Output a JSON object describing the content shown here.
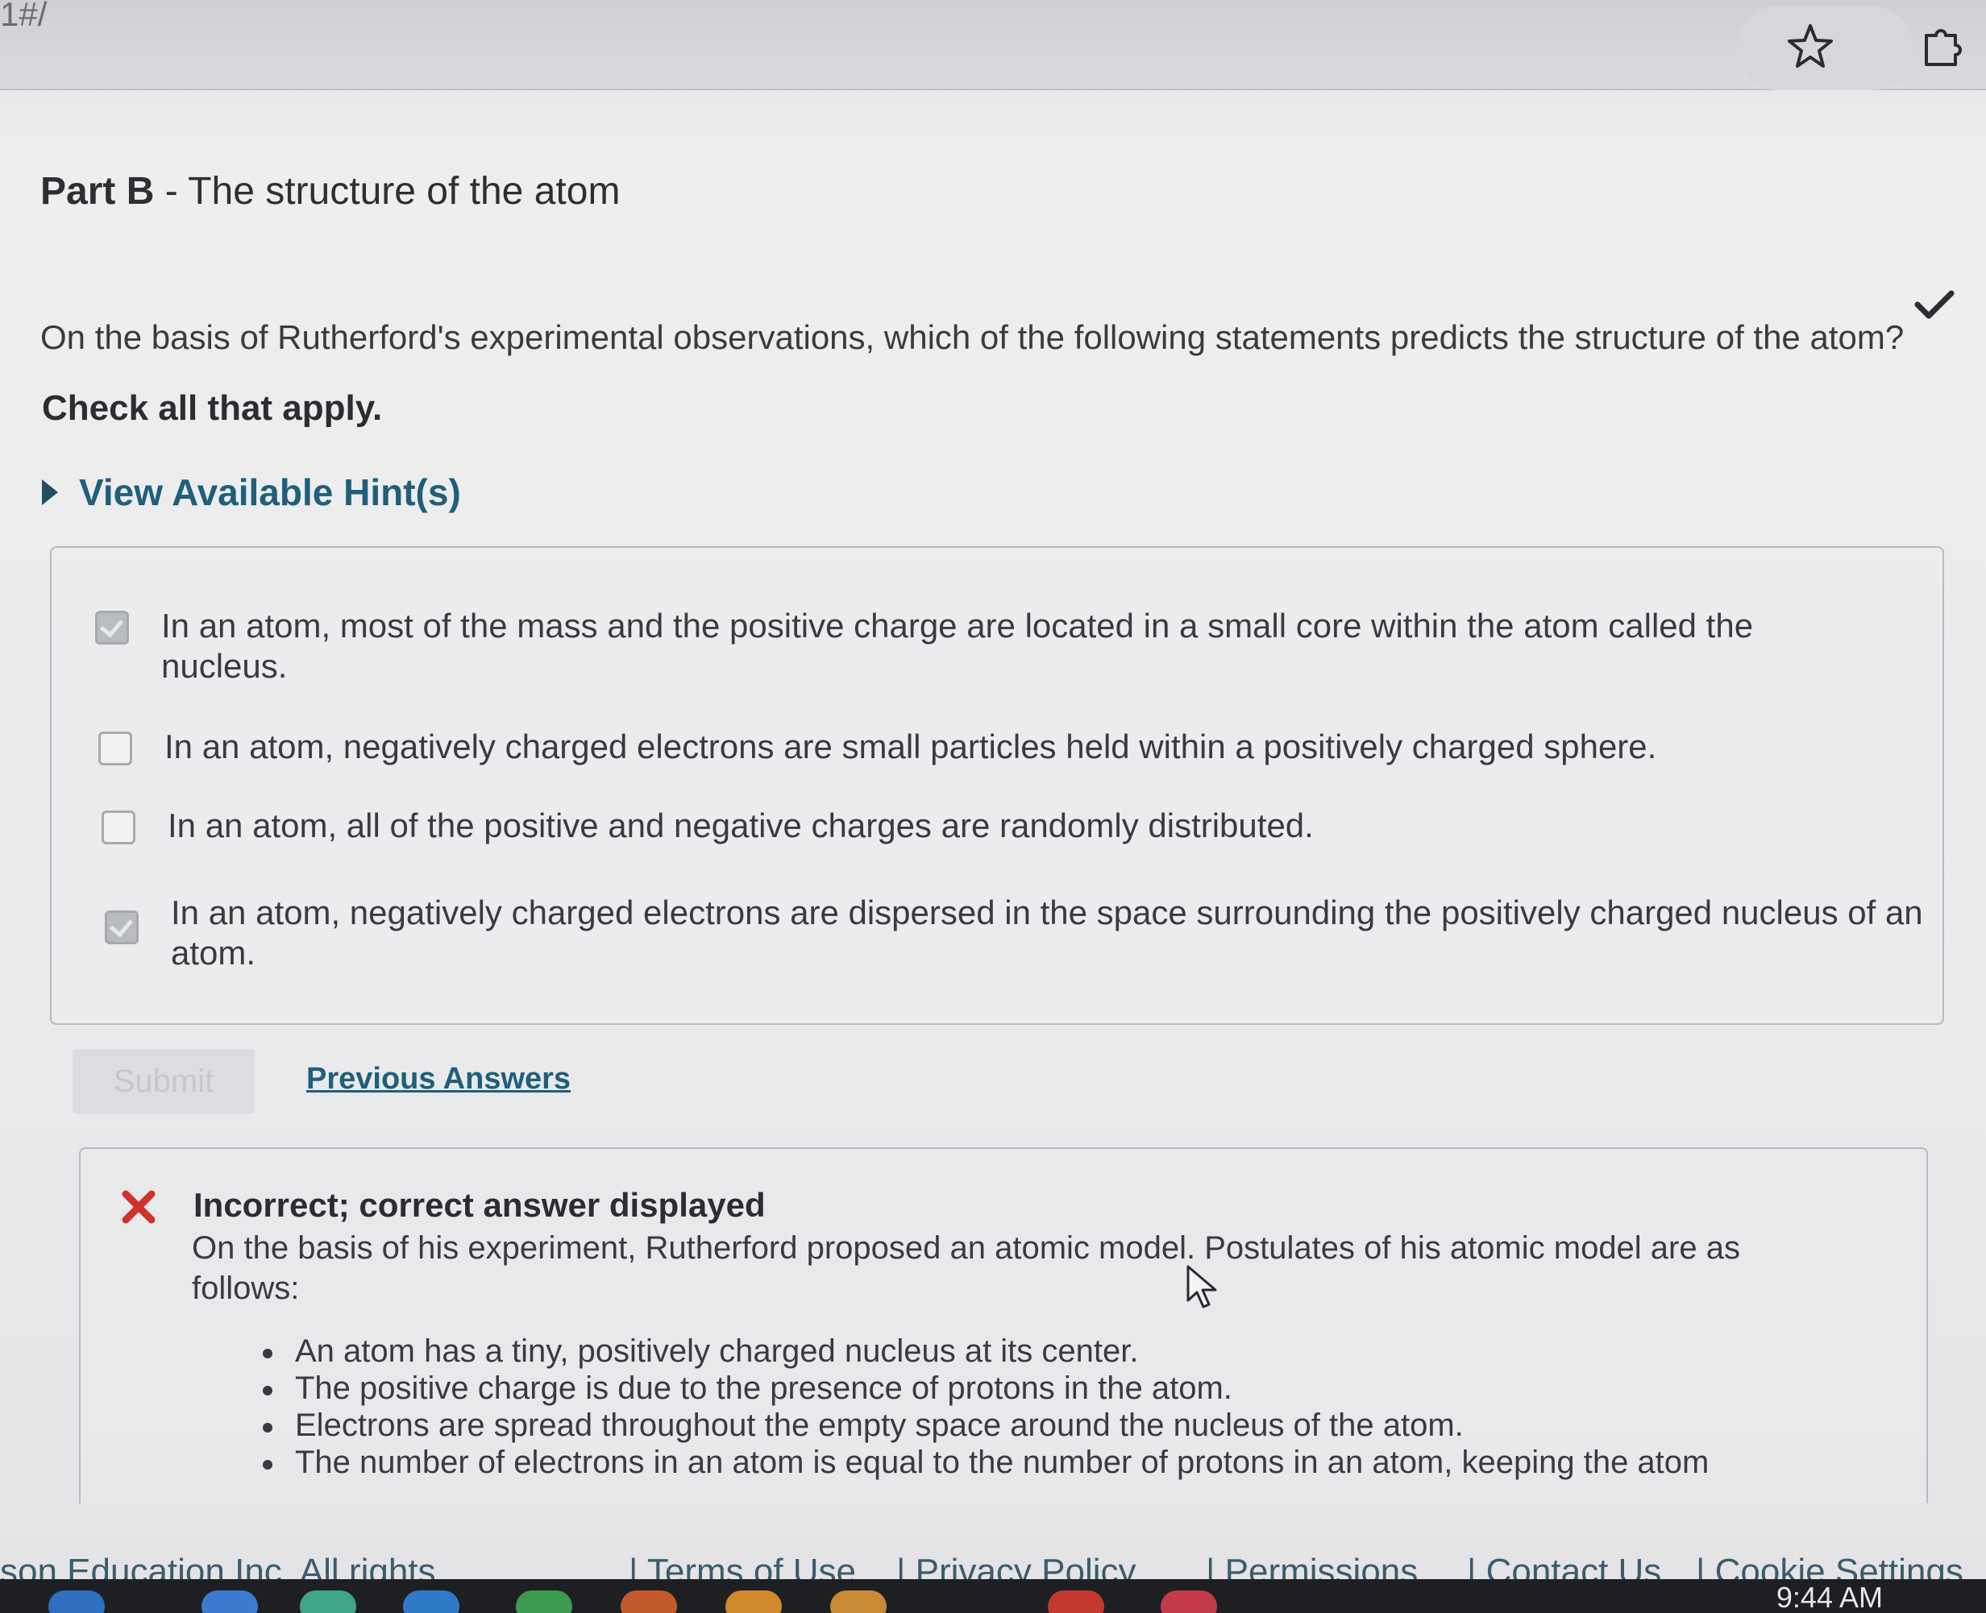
{
  "browser": {
    "url_fragment": "1#/",
    "star_icon": "star-icon",
    "extensions_icon": "puzzle-icon"
  },
  "part": {
    "label": "Part B",
    "separator": " - ",
    "title": "The structure of the atom"
  },
  "question": {
    "text": "On the basis of Rutherford's experimental observations, which of the following statements predicts the structure of the atom?",
    "instruction": "Check all that apply.",
    "hints_label": "View Available Hint(s)"
  },
  "options": [
    {
      "text": "In an atom, most of the mass and the positive charge are located in a small core within the atom called the nucleus.",
      "checked": true
    },
    {
      "text": "In an atom, negatively charged electrons are small particles held within a positively charged sphere.",
      "checked": false
    },
    {
      "text": "In an atom, all of the positive and negative charges are randomly distributed.",
      "checked": false
    },
    {
      "text": "In an atom, negatively charged electrons are dispersed in the space surrounding the positively charged nucleus of an atom.",
      "checked": true
    }
  ],
  "actions": {
    "submit_label": "Submit",
    "previous_answers_label": "Previous Answers"
  },
  "feedback": {
    "status": "Incorrect; correct answer displayed",
    "text": "On the basis of  his experiment, Rutherford proposed an atomic model. Postulates of his atomic model are as follows:",
    "points": [
      "An atom has a tiny, positively charged nucleus at its center.",
      "The positive charge is due to the presence of protons in the atom.",
      "Electrons are spread throughout the empty space around the nucleus of the atom.",
      "The number of electrons in an atom is equal to the number of protons in an atom, keeping the atom"
    ]
  },
  "footer": {
    "copyright": "son Education Inc. All rights",
    "links": [
      "| Terms of Use",
      "| Privacy Policy",
      "| Permissions",
      "| Contact Us",
      "| Cookie Settings"
    ]
  },
  "taskbar": {
    "time": "9:44 AM"
  },
  "colors": {
    "accent_link": "#1f5f7a",
    "incorrect_red": "#d0312d",
    "correct_check": "#2c2d31"
  }
}
